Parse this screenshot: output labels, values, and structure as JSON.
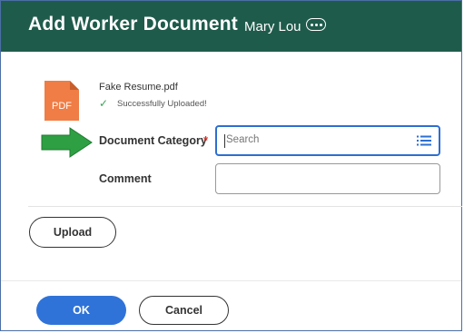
{
  "dialog": {
    "title": "Add Worker Document",
    "worker_name": "Mary Lou",
    "more_icon": "ellipsis-icon"
  },
  "file": {
    "icon": "pdf-file-icon",
    "icon_label": "PDF",
    "name": "Fake Resume.pdf",
    "status_icon": "check-icon",
    "status_text": "Successfully Uploaded!"
  },
  "form": {
    "document_category_label": "Document Category",
    "required_marker": "*",
    "search_placeholder": "Search",
    "list_icon": "list-prompt-icon",
    "comment_label": "Comment",
    "comment_value": ""
  },
  "actions": {
    "upload_label": "Upload",
    "ok_label": "OK",
    "cancel_label": "Cancel"
  },
  "colors": {
    "header_bg": "#1f5b4b",
    "primary_button": "#2f73d9",
    "pdf_icon": "#ef7d45",
    "annotation_arrow": "#2ea043",
    "required_star": "#d0372c",
    "success_check": "#3aa55a"
  }
}
